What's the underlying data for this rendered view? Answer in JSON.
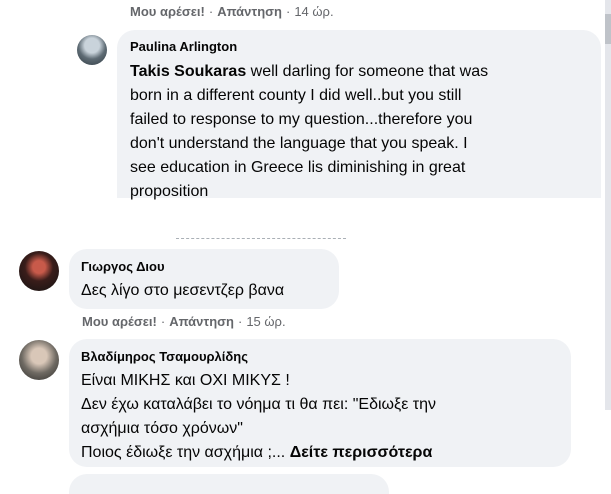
{
  "top_actions": {
    "like": "Μου αρέσει!",
    "reply": "Απάντηση",
    "time": "14 ώρ."
  },
  "comments": [
    {
      "author": "Paulina Arlington",
      "tagged": "Takis Soukaras",
      "text_lines": [
        "well darling for someone that was",
        "born in a different county I did well..but you still",
        "failed to response to my question...therefore you",
        "don't understand the language that you speak. I",
        "see education in Greece lis diminishing in great",
        "proposition"
      ]
    },
    {
      "author": "Γιωργος Διου",
      "text": "Δες λίγο στο μεσεντζερ βανα",
      "actions": {
        "like": "Μου αρέσει!",
        "reply": "Απάντηση",
        "time": "15 ώρ."
      }
    },
    {
      "author": "Βλαδίμηρος Τσαμουρλίδης",
      "text_lines": [
        "Είναι ΜΙΚΗΣ και ΟΧΙ ΜΙΚΥΣ !",
        "Δεν έχω καταλάβει το νόημα τι θα πει: \"Εδιωξε την",
        "ασχήμια τόσο χρόνων\"",
        "Ποιος έδιωξε την ασχήμια ;..."
      ],
      "see_more": "Δείτε περισσότερα"
    }
  ],
  "colors": {
    "bubble": "#f0f2f5",
    "meta": "#65676b",
    "text": "#050505"
  }
}
